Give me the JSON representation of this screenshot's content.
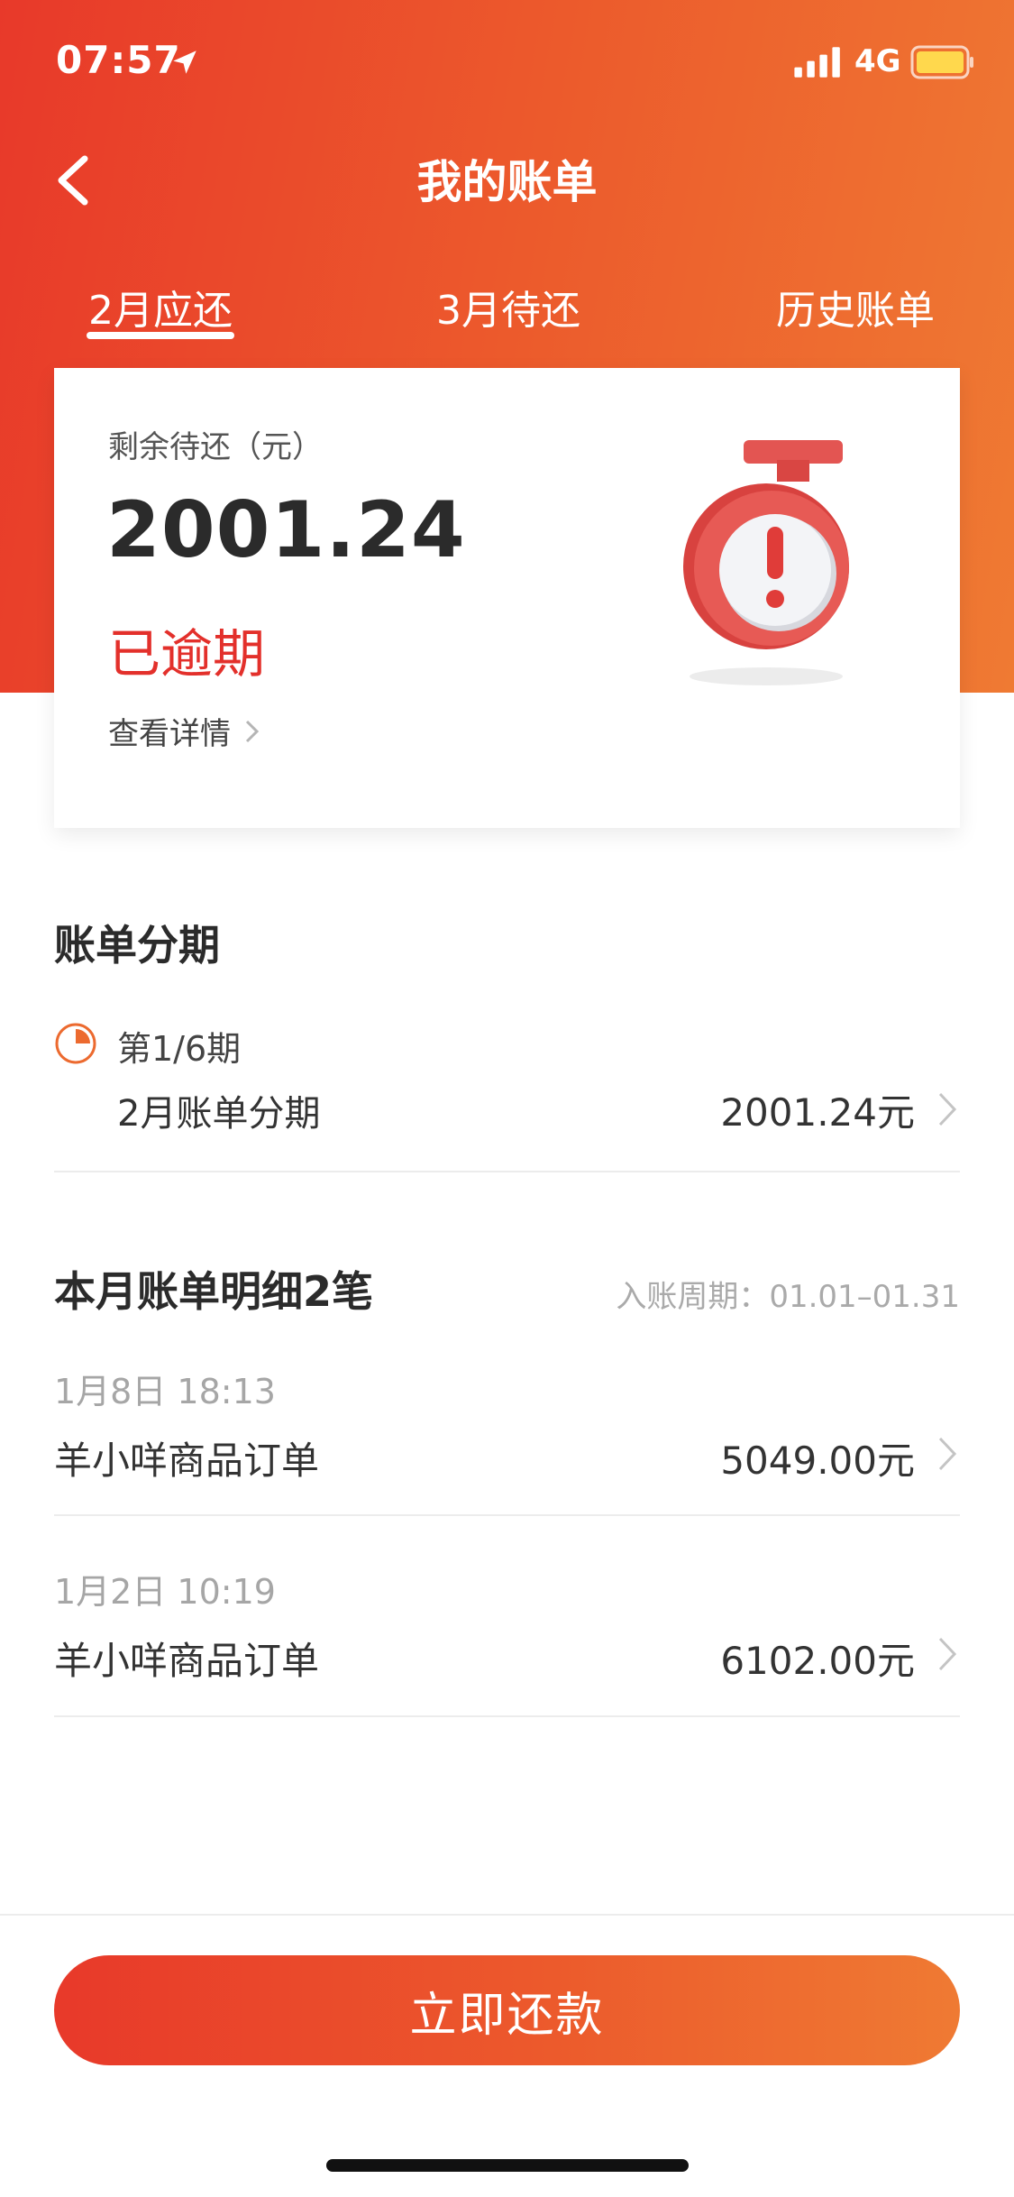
{
  "status_bar": {
    "time": "07:57",
    "network": "4G"
  },
  "header": {
    "title": "我的账单"
  },
  "tabs": [
    {
      "label": "2月应还",
      "active": true
    },
    {
      "label": "3月待还",
      "active": false
    },
    {
      "label": "历史账单",
      "active": false
    }
  ],
  "summary": {
    "remaining_label": "剩余待还（元）",
    "remaining_amount": "2001.24",
    "status": "已逾期",
    "detail_link": "查看详情"
  },
  "installment_section": {
    "title": "账单分期",
    "item": {
      "period": "第1/6期",
      "name": "2月账单分期",
      "amount": "2001.24元"
    }
  },
  "statement_section": {
    "title": "本月账单明细2笔",
    "cycle": "入账周期：01.01–01.31",
    "transactions": [
      {
        "date": "1月8日 18:13",
        "name": "羊小咩商品订单",
        "amount": "5049.00元"
      },
      {
        "date": "1月2日 10:19",
        "name": "羊小咩商品订单",
        "amount": "6102.00元"
      }
    ]
  },
  "pay_button": {
    "label": "立即还款"
  },
  "colors": {
    "brand_start": "#e8392a",
    "brand_end": "#ef7a33",
    "overdue": "#e3302b"
  }
}
